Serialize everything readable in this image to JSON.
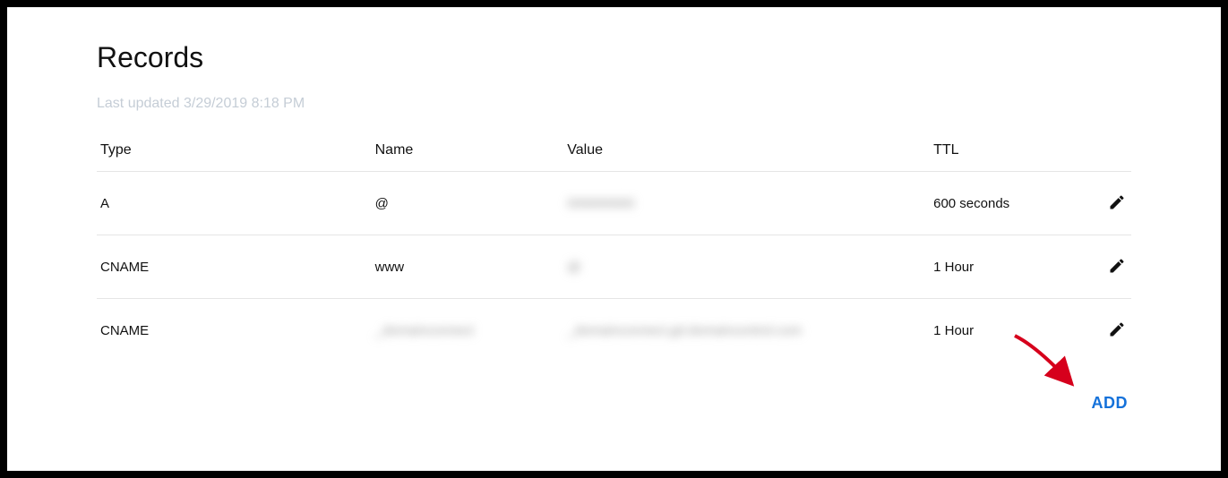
{
  "title": "Records",
  "last_updated": "Last updated 3/29/2019 8:18 PM",
  "columns": {
    "type": "Type",
    "name": "Name",
    "value": "Value",
    "ttl": "TTL"
  },
  "rows": [
    {
      "type": "A",
      "name": "@",
      "name_blur": false,
      "value": "000000000",
      "value_blur": true,
      "ttl": "600 seconds"
    },
    {
      "type": "CNAME",
      "name": "www",
      "name_blur": false,
      "value": "@",
      "value_blur": true,
      "ttl": "1 Hour"
    },
    {
      "type": "CNAME",
      "name": "_domainconnect",
      "name_blur": true,
      "value": "_domainconnect.gd.domaincontrol.com",
      "value_blur": true,
      "ttl": "1 Hour"
    }
  ],
  "add_label": "ADD",
  "icons": {
    "edit": "pencil-icon"
  }
}
